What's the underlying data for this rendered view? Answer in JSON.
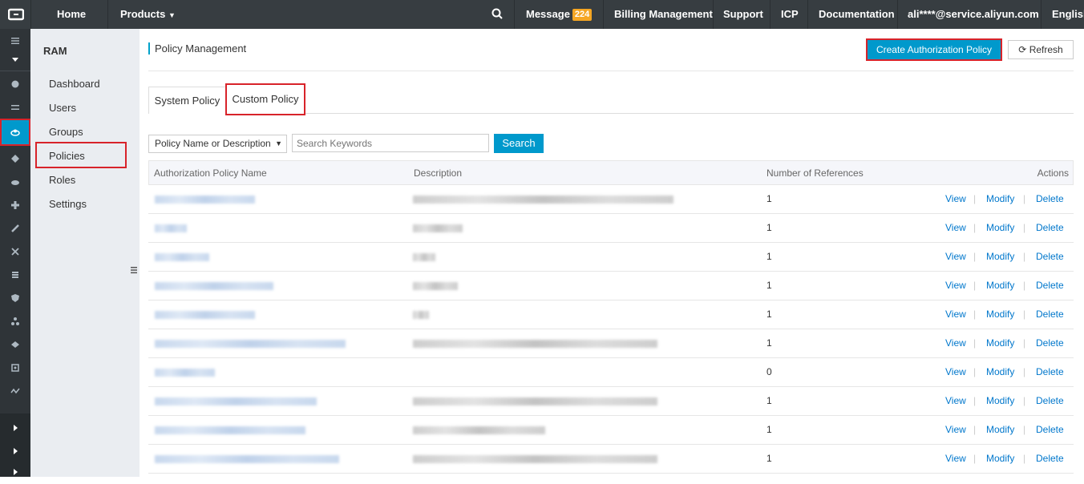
{
  "topbar": {
    "home": "Home",
    "products": "Products",
    "message": "Message",
    "message_count": "224",
    "billing": "Billing Management",
    "support": "Support",
    "icp": "ICP",
    "documentation": "Documentation",
    "account": "ali****@service.aliyun.com",
    "language": "English"
  },
  "sidebar": {
    "title": "RAM",
    "items": [
      "Dashboard",
      "Users",
      "Groups",
      "Policies",
      "Roles",
      "Settings"
    ]
  },
  "main": {
    "title": "Policy Management",
    "create_button": "Create Authorization Policy",
    "refresh_button": "Refresh",
    "tabs": [
      "System Policy",
      "Custom Policy"
    ],
    "filter_select": "Policy Name or Description",
    "search_placeholder": "Search Keywords",
    "search_button": "Search",
    "columns": [
      "Authorization Policy Name",
      "Description",
      "Number of References",
      "Actions"
    ],
    "actions": {
      "view": "View",
      "modify": "Modify",
      "delete": "Delete"
    },
    "rows": [
      {
        "references": "1"
      },
      {
        "references": "1"
      },
      {
        "references": "1"
      },
      {
        "references": "1"
      },
      {
        "references": "1"
      },
      {
        "references": "1"
      },
      {
        "references": "0"
      },
      {
        "references": "1"
      },
      {
        "references": "1"
      },
      {
        "references": "1"
      }
    ]
  },
  "colors": {
    "topbar": "#373d41",
    "accent": "#0099cc",
    "highlight": "#d8232a",
    "link": "#0077cc"
  }
}
